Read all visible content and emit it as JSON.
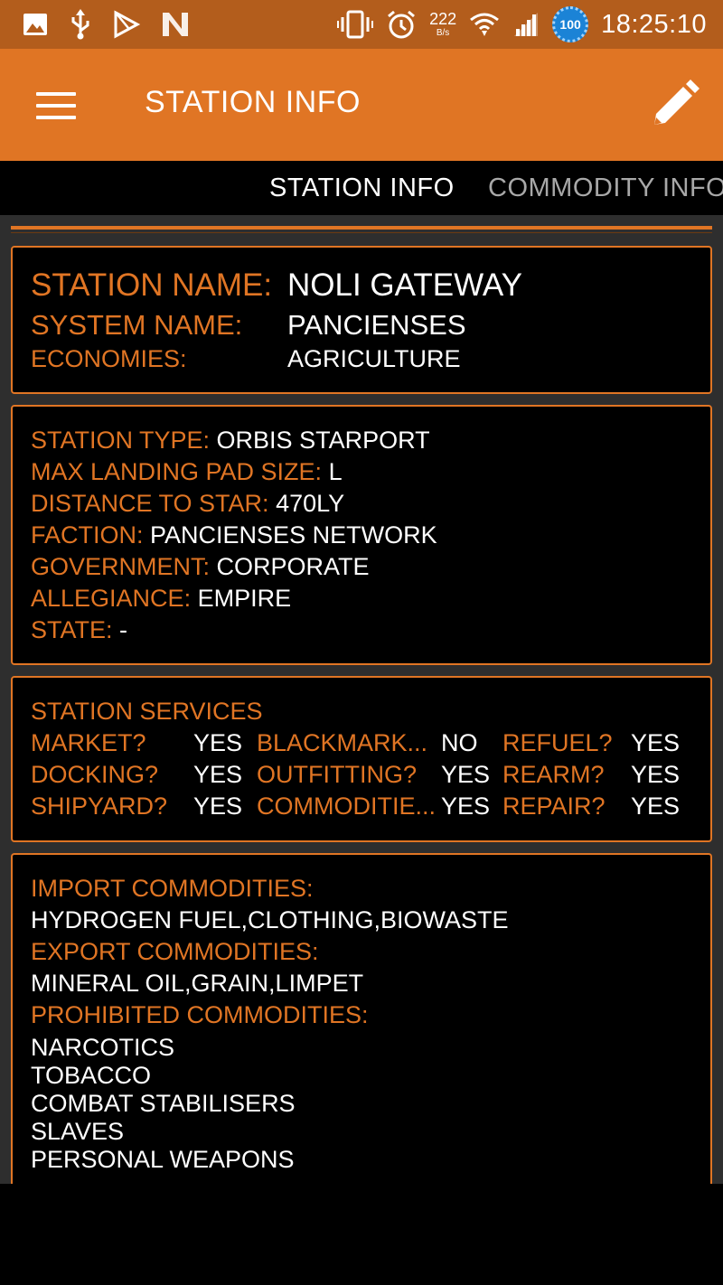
{
  "status_bar": {
    "left_icons": [
      "image-icon",
      "usb-icon",
      "play-store-icon",
      "n-app-icon"
    ],
    "network_speed": "222",
    "network_unit": "B/s",
    "battery": "100",
    "time": "18:25:10"
  },
  "app_bar": {
    "title": "STATION INFO"
  },
  "tabs": [
    {
      "label": "STATION INFO",
      "active": true
    },
    {
      "label": "COMMODITY INFO",
      "active": false
    }
  ],
  "identity": {
    "station_name_label": "STATION NAME:",
    "station_name": "NOLI GATEWAY",
    "system_name_label": "SYSTEM NAME:",
    "system_name": "PANCIENSES",
    "economies_label": "ECONOMIES:",
    "economies": "AGRICULTURE"
  },
  "details": [
    {
      "label": "STATION TYPE:",
      "value": "ORBIS STARPORT"
    },
    {
      "label": "MAX LANDING PAD SIZE:",
      "value": "L"
    },
    {
      "label": "DISTANCE TO STAR:",
      "value": "470LY"
    },
    {
      "label": "FACTION:",
      "value": "PANCIENSES NETWORK"
    },
    {
      "label": "GOVERNMENT:",
      "value": "CORPORATE"
    },
    {
      "label": "ALLEGIANCE:",
      "value": "EMPIRE"
    },
    {
      "label": "STATE:",
      "value": "-"
    }
  ],
  "services": {
    "title": "STATION SERVICES",
    "items": [
      {
        "label": "MARKET?",
        "value": "YES"
      },
      {
        "label": "BLACKMARK...",
        "value": "NO"
      },
      {
        "label": "REFUEL?",
        "value": "YES"
      },
      {
        "label": "DOCKING?",
        "value": "YES"
      },
      {
        "label": "OUTFITTING?",
        "value": "YES"
      },
      {
        "label": "REARM?",
        "value": "YES"
      },
      {
        "label": "SHIPYARD?",
        "value": "YES"
      },
      {
        "label": "COMMODITIE...",
        "value": "YES"
      },
      {
        "label": "REPAIR?",
        "value": "YES"
      }
    ]
  },
  "commodities": {
    "import_label": "IMPORT COMMODITIES:",
    "import_value": "HYDROGEN FUEL,CLOTHING,BIOWASTE",
    "export_label": "EXPORT COMMODITIES:",
    "export_value": "MINERAL OIL,GRAIN,LIMPET",
    "prohibited_label": "PROHIBITED COMMODITIES:",
    "prohibited": [
      "NARCOTICS",
      "TOBACCO",
      "COMBAT STABILISERS",
      "SLAVES",
      "PERSONAL WEAPONS"
    ]
  },
  "colors": {
    "accent": "#e07524",
    "status_bar": "#b35d1c",
    "background": "#000000",
    "content_bg": "#2e2e2e",
    "inactive_tab": "#a8a8a8"
  }
}
